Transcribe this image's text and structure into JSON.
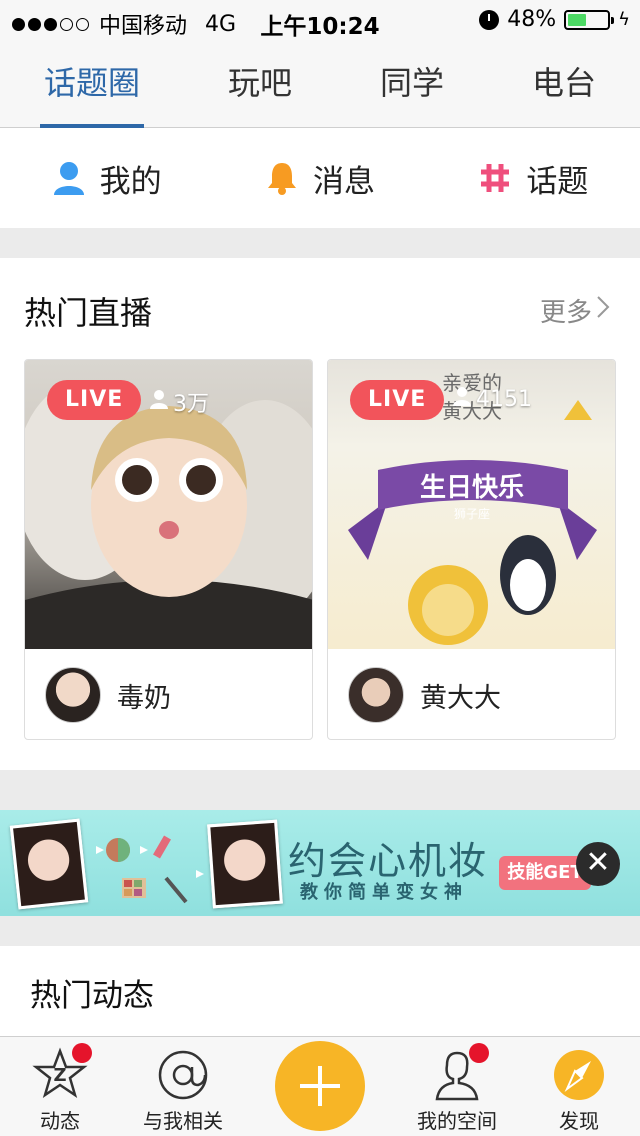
{
  "status_bar": {
    "carrier": "中国移动",
    "network": "4G",
    "time": "上午10:24",
    "battery_percent": "48%",
    "battery_level": 0.48,
    "signal_bars_filled": 3,
    "signal_bars_total": 5
  },
  "top_tabs": [
    {
      "label": "话题圈",
      "active": true
    },
    {
      "label": "玩吧",
      "active": false
    },
    {
      "label": "同学",
      "active": false
    },
    {
      "label": "电台",
      "active": false
    }
  ],
  "shortcuts": [
    {
      "label": "我的",
      "icon": "person-icon",
      "color": "#3c9cf0"
    },
    {
      "label": "消息",
      "icon": "bell-icon",
      "color": "#f79b22"
    },
    {
      "label": "话题",
      "icon": "hashtag-icon",
      "color": "#ef4f7d"
    }
  ],
  "hot_live": {
    "title": "热门直播",
    "more": "更多",
    "cards": [
      {
        "badge": "LIVE",
        "viewers": "3万",
        "name": "毒奶"
      },
      {
        "badge": "LIVE",
        "viewers": "4151",
        "name": "黄大大",
        "thumb_text_top": "亲爱的",
        "thumb_text_second": "黄大大",
        "thumb_banner": "生日快乐",
        "thumb_sub": "狮子座"
      }
    ]
  },
  "ad_banner": {
    "title": "约会心机妆",
    "subtitle": "教你简单变女神",
    "cta": "技能GET",
    "close": "✕"
  },
  "hot_feed": {
    "title": "热门动态"
  },
  "tab_bar": [
    {
      "label": "动态",
      "icon": "star-z-icon",
      "badge": true
    },
    {
      "label": "与我相关",
      "icon": "at-icon",
      "badge": false
    },
    {
      "label": "",
      "icon": "plus-icon",
      "badge": false
    },
    {
      "label": "我的空间",
      "icon": "profile-bust-icon",
      "badge": true
    },
    {
      "label": "发现",
      "icon": "compass-icon",
      "badge": false
    }
  ],
  "colors": {
    "accent": "#2e68a8",
    "live_badge": "#f2545b",
    "plus_button": "#f7b526",
    "badge_red": "#e5142b"
  }
}
